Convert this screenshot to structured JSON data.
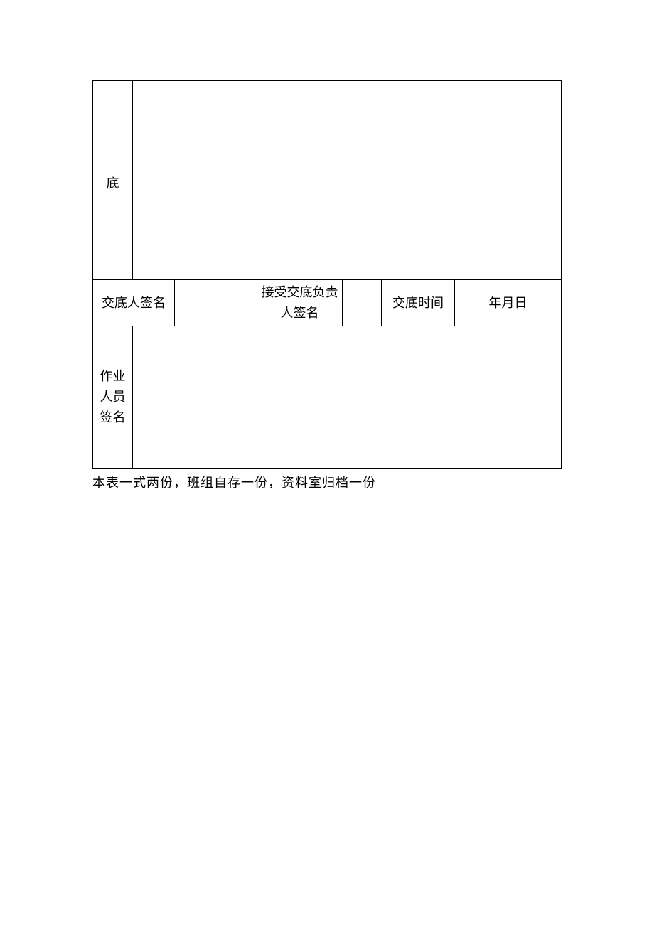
{
  "table": {
    "row1": {
      "label": "底"
    },
    "row2": {
      "signer_label": "交底人签名",
      "receiver_label": "接受交底负责人签名",
      "time_label": "交底时间",
      "date_value": "年月日"
    },
    "row3": {
      "worker_label": "作业人员签名"
    }
  },
  "footnote": "本表一式两份，班组自存一份，资料室归档一份"
}
